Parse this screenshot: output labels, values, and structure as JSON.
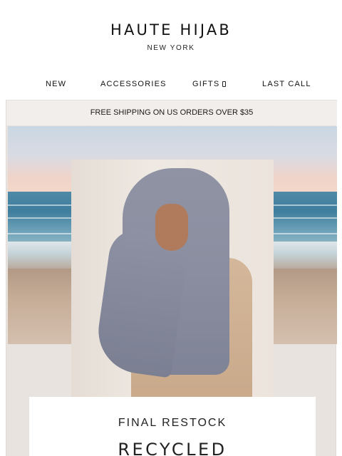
{
  "header": {
    "logo_title": "HAUTE HIJAB",
    "logo_subtitle": "NEW YORK"
  },
  "nav": {
    "items": [
      {
        "label": "NEW"
      },
      {
        "label": "ACCESSORIES"
      },
      {
        "label": "GIFTS",
        "icon": "chevron-down-icon"
      },
      {
        "label": "LAST CALL"
      }
    ]
  },
  "promo": {
    "text": "FREE SHIPPING ON US ORDERS OVER $35"
  },
  "hero": {
    "kicker": "FINAL RESTOCK",
    "title": "RECYCLED"
  }
}
